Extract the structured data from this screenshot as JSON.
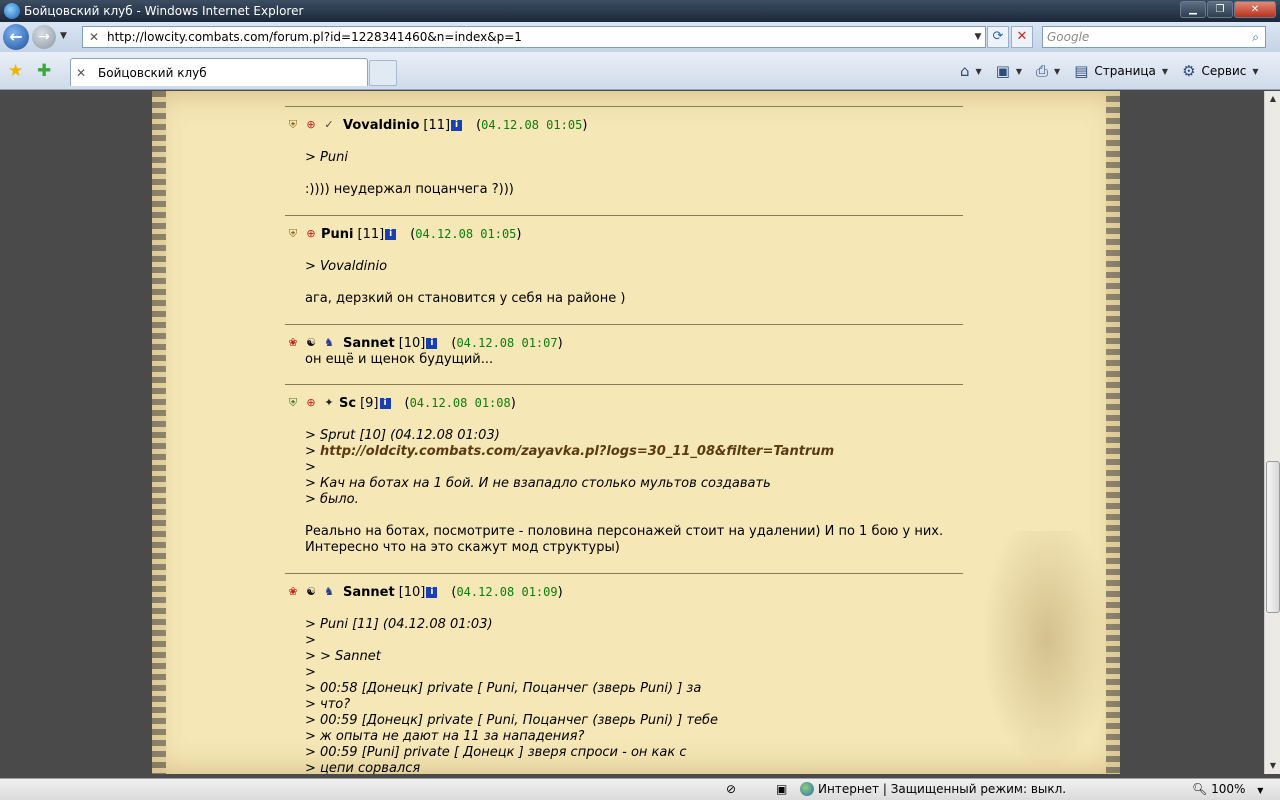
{
  "window": {
    "title": "Бойцовский клуб - Windows Internet Explorer",
    "min_glyph": "▁",
    "max_glyph": "❐",
    "close_glyph": "✕"
  },
  "address_bar": {
    "url": "http://lowcity.combats.com/forum.pl?id=1228341460&n=index&p=1",
    "search_placeholder": "Google"
  },
  "tab": {
    "title": "Бойцовский клуб"
  },
  "toolbar": {
    "page_label": "Страница",
    "tools_label": "Сервис"
  },
  "posts": [
    {
      "nick": "Vovaldinio",
      "level": "[11]",
      "date": "04.12.08 01:05",
      "icons": [
        "shield-icon",
        "clan-icon",
        "rank-icon"
      ],
      "quote": [
        "> Puni"
      ],
      "text": [
        ":)))) неудержал поцанчега ?)))"
      ]
    },
    {
      "nick": "Puni",
      "level": "[11]",
      "date": "04.12.08 01:05",
      "icons": [
        "shield-icon",
        "clan-icon"
      ],
      "quote": [
        "> Vovaldinio"
      ],
      "text": [
        "ага, дерзкий он становится у себя на районе )"
      ]
    },
    {
      "nick": "Sannet",
      "level": "[10]",
      "date": "04.12.08 01:07",
      "icons": [
        "shield-icon",
        "yinyang-icon",
        "clan-icon"
      ],
      "quote": [],
      "text": [
        "он ещё и щенок будущий..."
      ]
    },
    {
      "nick": "Sc",
      "level": "[9]",
      "date": "04.12.08 01:08",
      "icons": [
        "shield-icon",
        "clan-icon",
        "rank-icon"
      ],
      "quote": [
        "> Sprut [10]   (04.12.08 01:03)",
        "> http://oldcity.combats.com/zayavka.pl?logs=30_11_08&filter=Tantrum",
        ">",
        "> Кач на ботах на 1 бой. И не взападло столько мультов создавать",
        "> было."
      ],
      "text": [
        "Реально на ботах, посмотрите - половина персонажей стоит на удалении) И по 1 бою у них.",
        "Интересно что на это скажут мод структуры)"
      ]
    },
    {
      "nick": "Sannet",
      "level": "[10]",
      "date": "04.12.08 01:09",
      "icons": [
        "shield-icon",
        "yinyang-icon",
        "clan-icon"
      ],
      "quote": [
        "> Puni [11]   (04.12.08 01:03)",
        ">",
        "> > Sannet",
        ">",
        "> 00:58 [Донецк] private [ Puni, Поцанчег (зверь Puni) ] за",
        "> что?",
        "> 00:59 [Донецк] private [ Puni, Поцанчег (зверь Puni) ] тебе",
        "> ж опыта не дают на 11 за нападения?",
        "> 00:59 [Puni] private [ Донецк ] зверя спроси - он как с",
        "> цепи сорвался"
      ],
      "text": []
    }
  ],
  "status": {
    "zone": "Интернет | Защищенный режим: выкл.",
    "zoom": "100%"
  },
  "colors": {
    "paper": "#f5e7b6",
    "date": "#0b7d0b",
    "info_badge": "#1a3fb5"
  }
}
